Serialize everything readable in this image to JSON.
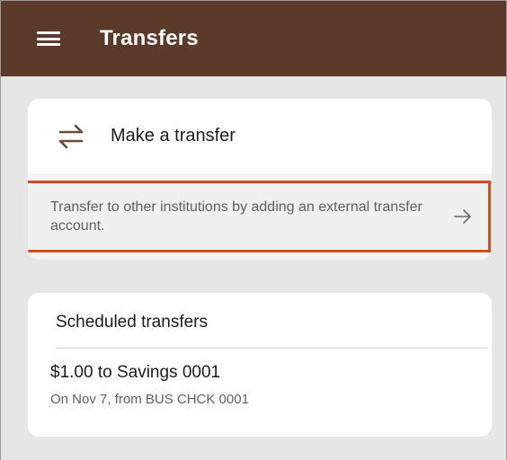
{
  "appbar": {
    "title": "Transfers",
    "menu_icon": "menu-icon"
  },
  "make_transfer": {
    "title": "Make a transfer",
    "icon": "swap-arrows-icon",
    "icon_color": "#6b4a35",
    "external_link_text": "Transfer to other institutions by adding an external transfer account.",
    "external_link_icon": "arrow-right-icon",
    "highlight_color": "#d84a1b"
  },
  "scheduled": {
    "title": "Scheduled transfers",
    "items": [
      {
        "amount_text": "$1.00 to Savings 0001",
        "detail": "On Nov 7, from BUS CHCK 0001"
      }
    ]
  },
  "colors": {
    "appbar_bg": "#5b3a29",
    "page_bg": "#e6e6e6",
    "card_bg": "#ffffff"
  }
}
